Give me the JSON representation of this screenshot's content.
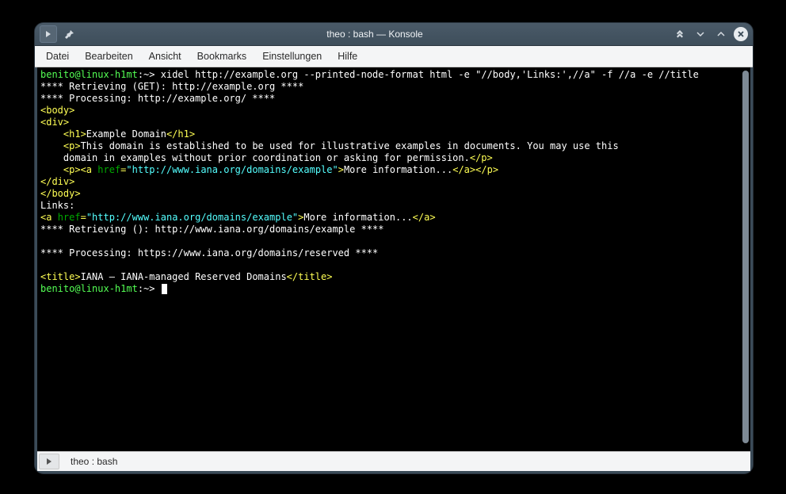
{
  "window": {
    "title": "theo : bash — Konsole"
  },
  "menubar": {
    "items": [
      "Datei",
      "Bearbeiten",
      "Ansicht",
      "Bookmarks",
      "Einstellungen",
      "Hilfe"
    ]
  },
  "tab": {
    "label": "theo : bash"
  },
  "terminal": {
    "prompt1_user": "benito@linux-h1mt",
    "prompt1_path": ":~>",
    "command1": " xidel http://example.org --printed-node-format html -e \"//body,'Links:',//a\" -f //a -e //title",
    "line_retr1": "**** Retrieving (GET): http://example.org ****",
    "line_proc1": "**** Processing: http://example.org/ ****",
    "body_open": "<body>",
    "div_open": "<div>",
    "h1_open": "    <h1>",
    "h1_text": "Example Domain",
    "h1_close": "</h1>",
    "p1_open": "    <p>",
    "p1_text1": "This domain is established to be used for illustrative examples in documents. You may use this",
    "p1_text2": "    domain in examples without prior coordination or asking for permission.",
    "p_close": "</p>",
    "p2_open": "    <p>",
    "a_open": "<a ",
    "href_attr": "href",
    "eq": "=",
    "href_val1": "\"http://www.iana.org/domains/example\"",
    "gt": ">",
    "a_text1": "More information...",
    "a_close": "</a>",
    "div_close": "</div>",
    "body_close": "</body>",
    "links_label": "Links:",
    "line_retr2": "**** Retrieving (): http://www.iana.org/domains/example ****",
    "blank": "",
    "line_proc2": "**** Processing: https://www.iana.org/domains/reserved ****",
    "title_open": "<title>",
    "title_text": "IANA — IANA-managed Reserved Domains",
    "title_close": "</title>",
    "prompt2_user": "benito@linux-h1mt",
    "prompt2_path": ":~>",
    "cursor": " "
  }
}
